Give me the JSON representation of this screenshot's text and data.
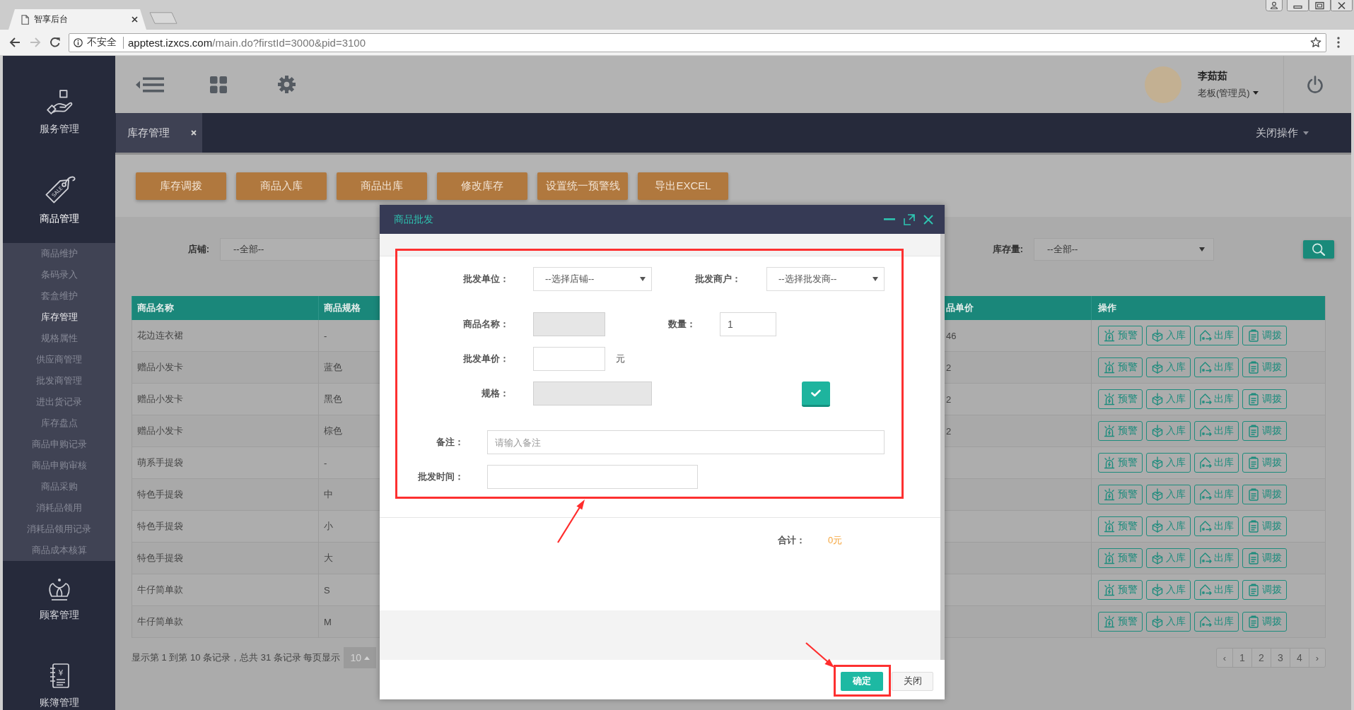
{
  "browser": {
    "tab_title": "智享后台",
    "security_label": "不安全",
    "url_host": "apptest.izxcs.com",
    "url_path": "/main.do?firstId=3000&pid=3100"
  },
  "header": {
    "user_name": "李茹茹",
    "user_role": "老板(管理员)"
  },
  "sidebar": {
    "items": [
      {
        "label": "服务管理",
        "expanded": false
      },
      {
        "label": "商品管理",
        "icon_text": "SALE",
        "expanded": true,
        "children": [
          {
            "label": "商品维护",
            "selected": false
          },
          {
            "label": "条码录入",
            "selected": false
          },
          {
            "label": "套盒维护",
            "selected": false
          },
          {
            "label": "库存管理",
            "selected": true
          },
          {
            "label": "规格属性",
            "selected": false
          },
          {
            "label": "供应商管理",
            "selected": false
          },
          {
            "label": "批发商管理",
            "selected": false
          },
          {
            "label": "进出货记录",
            "selected": false
          },
          {
            "label": "库存盘点",
            "selected": false
          },
          {
            "label": "商品申购记录",
            "selected": false
          },
          {
            "label": "商品申购审核",
            "selected": false
          },
          {
            "label": "商品采购",
            "selected": false
          },
          {
            "label": "消耗品领用",
            "selected": false
          },
          {
            "label": "消耗品领用记录",
            "selected": false
          },
          {
            "label": "商品成本核算",
            "selected": false
          }
        ]
      },
      {
        "label": "顾客管理",
        "expanded": false
      },
      {
        "label": "账簿管理",
        "icon_text": "¥",
        "expanded": false
      }
    ]
  },
  "tabs": [
    {
      "label": "库存管理",
      "selected": true
    }
  ],
  "tab_menu": "关闭操作",
  "toolbar": [
    "库存调拨",
    "商品入库",
    "商品出库",
    "修改库存",
    "设置统一预警线",
    "导出EXCEL"
  ],
  "filters": [
    {
      "label": "店铺:",
      "value": "--全部--"
    },
    {
      "label": "库存量:",
      "value": "--全部--"
    }
  ],
  "table": {
    "columns": [
      "商品名称",
      "商品规格",
      "品单价",
      "操作"
    ],
    "rows": [
      {
        "cells": [
          "花边连衣裙",
          "-",
          "46"
        ],
        "actions": [
          "预警",
          "入库",
          "出库",
          "调拨"
        ]
      },
      {
        "cells": [
          "赠品小发卡",
          "蓝色",
          "2"
        ],
        "actions": [
          "预警",
          "入库",
          "出库",
          "调拨"
        ]
      },
      {
        "cells": [
          "赠品小发卡",
          "黑色",
          "2"
        ],
        "actions": [
          "预警",
          "入库",
          "出库",
          "调拨"
        ]
      },
      {
        "cells": [
          "赠品小发卡",
          "棕色",
          "2"
        ],
        "actions": [
          "预警",
          "入库",
          "出库",
          "调拨"
        ]
      },
      {
        "cells": [
          "萌系手提袋",
          "-"
        ],
        "actions": [
          "预警",
          "入库",
          "出库",
          "调拨"
        ]
      },
      {
        "cells": [
          "特色手提袋",
          "中"
        ],
        "actions": [
          "预警",
          "入库",
          "出库",
          "调拨"
        ]
      },
      {
        "cells": [
          "特色手提袋",
          "小"
        ],
        "actions": [
          "预警",
          "入库",
          "出库",
          "调拨"
        ]
      },
      {
        "cells": [
          "特色手提袋",
          "大"
        ],
        "actions": [
          "预警",
          "入库",
          "出库",
          "调拨"
        ]
      },
      {
        "cells": [
          "牛仔简单款",
          "S"
        ],
        "actions": [
          "预警",
          "入库",
          "出库",
          "调拨"
        ]
      },
      {
        "cells": [
          "牛仔简单款",
          "M"
        ],
        "actions": [
          "预警",
          "入库",
          "出库",
          "调拨"
        ]
      }
    ]
  },
  "pagination": {
    "summary": "显示第 1 到第 10 条记录，总共 31 条记录 每页显示",
    "page_size": "10",
    "pages": [
      "‹",
      "1",
      "2",
      "3",
      "4",
      "›"
    ]
  },
  "dialog": {
    "title": "商品批发",
    "fields": [
      {
        "label": "批发单位：",
        "kind": "select",
        "value": "--选择店铺--"
      },
      {
        "label": "批发商户：",
        "kind": "select",
        "value": "--选择批发商--"
      },
      {
        "label": "商品名称：",
        "kind": "input",
        "disabled": true
      },
      {
        "label": "数量：",
        "kind": "input",
        "disabled": false,
        "value": "1"
      },
      {
        "label": "批发单价：",
        "kind": "input",
        "disabled": false,
        "unit": "元"
      },
      {
        "label": "规格：",
        "kind": "input",
        "disabled": true
      },
      {
        "label": "备注：",
        "kind": "input",
        "disabled": false,
        "placeholder": "请输入备注"
      },
      {
        "label": "批发时间：",
        "kind": "input",
        "disabled": false
      }
    ],
    "total_label": "合计：",
    "total_value": "0元",
    "buttons": [
      {
        "label": "确定",
        "kind": "primary"
      },
      {
        "label": "关闭",
        "kind": "default"
      }
    ]
  }
}
